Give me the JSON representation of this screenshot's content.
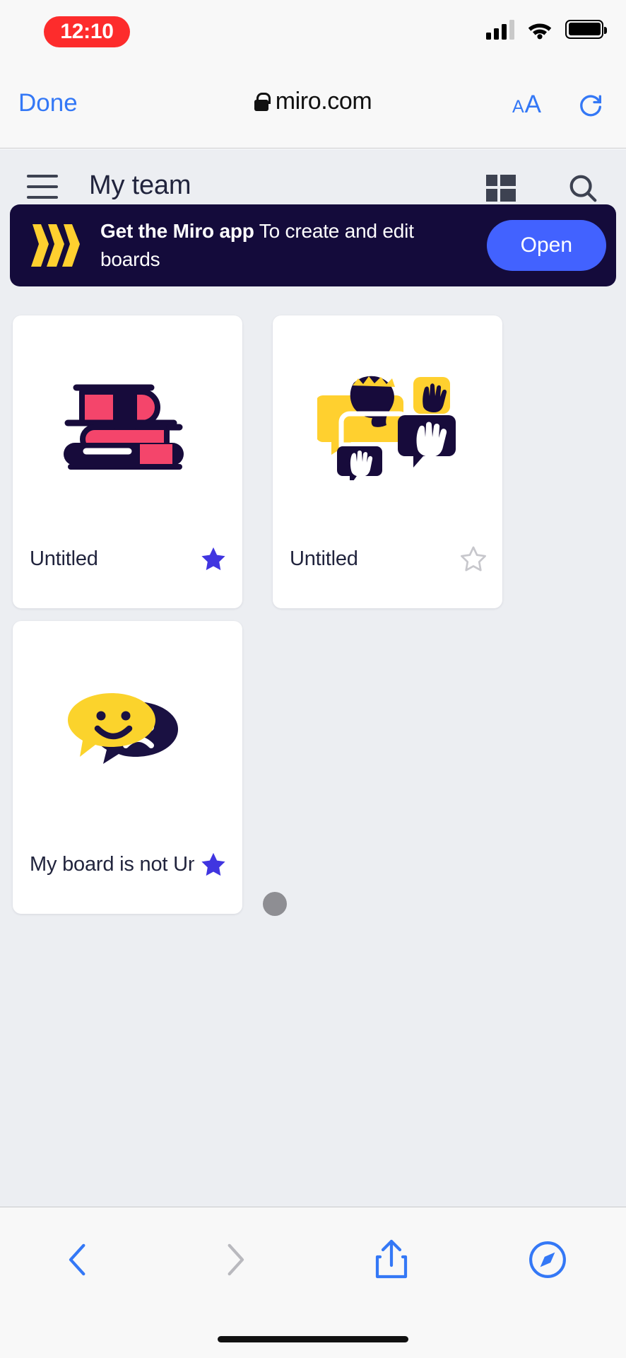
{
  "status_bar": {
    "time": "12:10",
    "recording_indicator": true,
    "signal_icon": "cellular-signal-icon",
    "wifi_icon": "wifi-icon",
    "battery_icon": "battery-icon"
  },
  "browser_bar": {
    "done_label": "Done",
    "lock_icon": "lock-icon",
    "url": "miro.com",
    "text_size_small": "A",
    "text_size_large": "A",
    "reload_icon": "reload-icon"
  },
  "app_header": {
    "menu_icon": "hamburger-menu-icon",
    "title": "My team",
    "layout_icon": "grid-layout-icon",
    "search_icon": "search-icon"
  },
  "banner": {
    "logo_icon": "miro-logo-icon",
    "headline": "Get the Miro app",
    "subtext": " To create and edit boards",
    "button_label": "Open",
    "background_color": "#140b3b",
    "button_color": "#4262FF",
    "logo_color": "#FFD02F"
  },
  "boards": [
    {
      "title": "Untitled",
      "favorite": true,
      "thumbnail": "books-illustration",
      "star_icon": "star-filled-icon"
    },
    {
      "title": "Untitled",
      "favorite": false,
      "thumbnail": "people-speech-illustration",
      "star_icon": "star-outline-icon"
    },
    {
      "title": "My board is not Unt...",
      "favorite": true,
      "thumbnail": "speech-bubbles-illustration",
      "star_icon": "star-filled-icon"
    }
  ],
  "loading_indicator": {
    "name": "loading-dot",
    "color": "#8e8e93"
  },
  "bottom_toolbar": {
    "back_icon": "chevron-back-icon",
    "forward_icon": "chevron-forward-icon",
    "share_icon": "share-icon",
    "tabs_icon": "compass-icon"
  },
  "colors": {
    "accent_blue": "#3478F6",
    "miro_blue": "#4262FF",
    "star_blue": "#4035E0",
    "star_gray": "#c7c7cc",
    "page_bg": "#eceef2",
    "navy": "#140b3b",
    "pink": "#F4456B",
    "yellow": "#FFD02F"
  }
}
